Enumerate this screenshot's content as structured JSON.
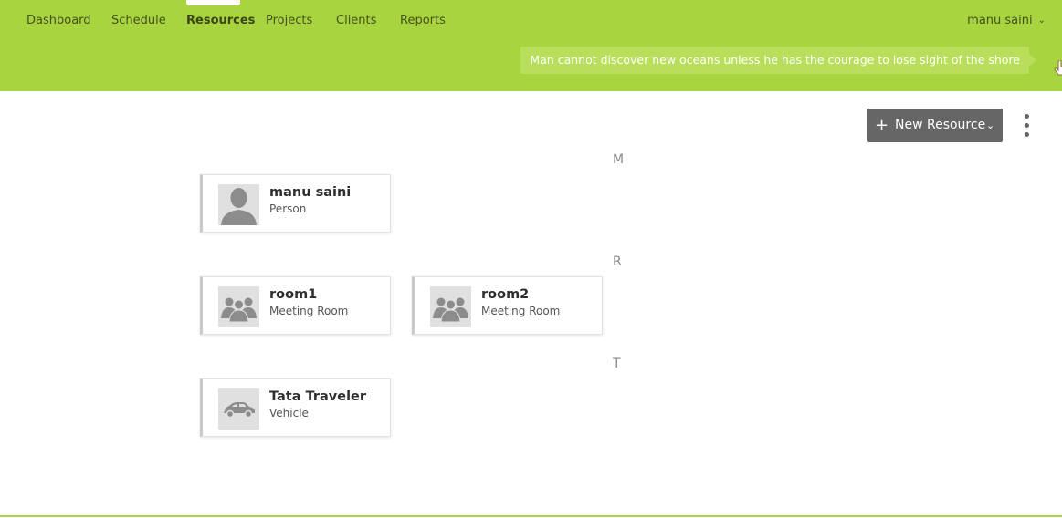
{
  "nav": {
    "items": [
      {
        "label": "Dashboard"
      },
      {
        "label": "Schedule"
      },
      {
        "label": "Resources",
        "active": true
      },
      {
        "label": "Projects"
      },
      {
        "label": "Clients"
      },
      {
        "label": "Reports"
      }
    ],
    "user": "manu saini",
    "user_chevron": "chevron-down-icon"
  },
  "quote": "Man cannot discover new oceans unless he has the courage to lose sight of the shore",
  "toolbar": {
    "new_resource_label": "New Resource",
    "new_resource_icon": "plus-icon",
    "menu_icon": "more-vertical-icon"
  },
  "groups": [
    {
      "letter": "M",
      "resources": [
        {
          "name": "manu saini",
          "type": "Person",
          "icon": "person-icon"
        }
      ]
    },
    {
      "letter": "R",
      "resources": [
        {
          "name": "room1",
          "type": "Meeting Room",
          "icon": "group-icon"
        },
        {
          "name": "room2",
          "type": "Meeting Room",
          "icon": "group-icon"
        }
      ]
    },
    {
      "letter": "T",
      "resources": [
        {
          "name": "Tata Traveler",
          "type": "Vehicle",
          "icon": "car-icon"
        }
      ]
    }
  ],
  "colors": {
    "header_bg": "#a8d53f",
    "button_bg": "#666666",
    "quote_bg": "#b8de5c"
  }
}
